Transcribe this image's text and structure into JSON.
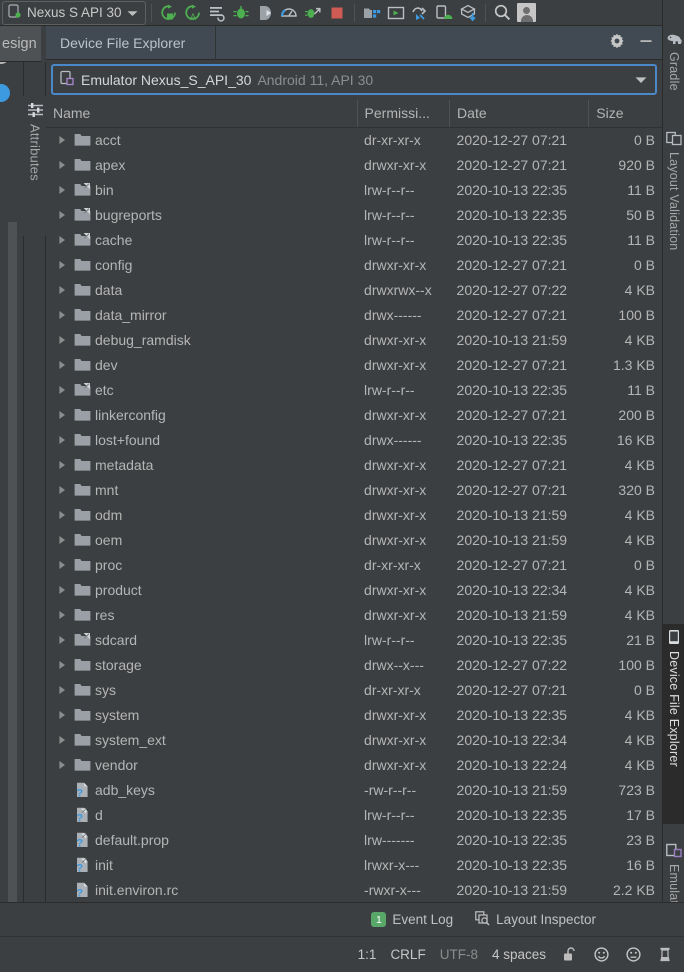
{
  "toolbar": {
    "device_selector_label": "Nexus S API 30",
    "device_selector_icon": "device-phone-icon",
    "buttons": [
      {
        "name": "run-button",
        "icon": "run-icon",
        "label": "Run"
      },
      {
        "name": "apply-changes-button",
        "icon": "apply-changes-icon",
        "label": "Apply Changes"
      },
      {
        "name": "apply-code-changes-button",
        "icon": "apply-code-changes-icon",
        "label": "Apply Code Changes"
      },
      {
        "name": "debug-button",
        "icon": "debug-icon",
        "label": "Debug"
      },
      {
        "name": "attach-debugger-button",
        "icon": "attach-debugger-icon",
        "label": "Attach Debugger to Android Process"
      },
      {
        "name": "profiler-button",
        "icon": "profiler-icon",
        "label": "Profile"
      },
      {
        "name": "run-with-coverage-button",
        "icon": "run-coverage-icon",
        "label": "Run with Coverage"
      },
      {
        "name": "stop-button",
        "icon": "stop-icon",
        "label": "Stop"
      },
      {
        "name": "sdk-manager-button",
        "icon": "sdk-manager-icon",
        "label": "SDK Manager"
      },
      {
        "name": "avd-manager-button",
        "icon": "avd-manager-icon",
        "label": "AVD Manager"
      },
      {
        "name": "layout-inspector-button",
        "icon": "layout-inspector-icon",
        "label": "Layout Inspector"
      },
      {
        "name": "device-manager-button",
        "icon": "device-android-icon",
        "label": "Device Manager"
      },
      {
        "name": "sync-gradle-button",
        "icon": "sync-project-icon",
        "label": "Sync Project with Gradle Files"
      },
      {
        "name": "search-everywhere-button",
        "icon": "search-icon",
        "label": "Search Everywhere"
      },
      {
        "name": "account-button",
        "icon": "avatar-icon",
        "label": "Account"
      }
    ]
  },
  "left_rail": {
    "design_tab_label": "esign",
    "attributes_tab_label": "Attributes",
    "attributes_tab_icon": "sliders-icon"
  },
  "right_rail": {
    "tabs": [
      {
        "name": "gradle",
        "label": "Gradle",
        "icon": "elephant-icon",
        "active": false
      },
      {
        "name": "layout-validation",
        "label": "Layout Validation",
        "icon": "layout-validation-icon",
        "active": false
      },
      {
        "name": "device-file-explorer",
        "label": "Device File Explorer",
        "icon": "device-phone-icon",
        "active": true
      },
      {
        "name": "emulator",
        "label": "Emulator",
        "icon": "emulator-icon",
        "active": false
      }
    ]
  },
  "tool_window": {
    "title": "Device File Explorer",
    "settings_icon": "gear-icon",
    "minimize_icon": "minimize-icon",
    "device_selector": {
      "icon": "device-phone-icon",
      "name": "Emulator Nexus_S_API_30",
      "detail": "Android 11, API 30",
      "chevron_icon": "chevron-down-icon"
    }
  },
  "file_table": {
    "columns": [
      "Name",
      "Permissi...",
      "Date",
      "Size"
    ],
    "rows": [
      {
        "name": "acct",
        "type": "folder",
        "expandable": true,
        "permissions": "dr-xr-xr-x",
        "date": "2020-12-27 07:21",
        "size": "0 B"
      },
      {
        "name": "apex",
        "type": "folder",
        "expandable": true,
        "permissions": "drwxr-xr-x",
        "date": "2020-12-27 07:21",
        "size": "920 B"
      },
      {
        "name": "bin",
        "type": "symfolder",
        "expandable": true,
        "permissions": "lrw-r--r--",
        "date": "2020-10-13 22:35",
        "size": "11 B"
      },
      {
        "name": "bugreports",
        "type": "symfolder",
        "expandable": true,
        "permissions": "lrw-r--r--",
        "date": "2020-10-13 22:35",
        "size": "50 B"
      },
      {
        "name": "cache",
        "type": "symfolder",
        "expandable": true,
        "permissions": "lrw-r--r--",
        "date": "2020-10-13 22:35",
        "size": "11 B"
      },
      {
        "name": "config",
        "type": "folder",
        "expandable": true,
        "permissions": "drwxr-xr-x",
        "date": "2020-12-27 07:21",
        "size": "0 B"
      },
      {
        "name": "data",
        "type": "folder",
        "expandable": true,
        "permissions": "drwxrwx--x",
        "date": "2020-12-27 07:22",
        "size": "4 KB"
      },
      {
        "name": "data_mirror",
        "type": "folder",
        "expandable": true,
        "permissions": "drwx------",
        "date": "2020-12-27 07:21",
        "size": "100 B"
      },
      {
        "name": "debug_ramdisk",
        "type": "folder",
        "expandable": true,
        "permissions": "drwxr-xr-x",
        "date": "2020-10-13 21:59",
        "size": "4 KB"
      },
      {
        "name": "dev",
        "type": "folder",
        "expandable": true,
        "permissions": "drwxr-xr-x",
        "date": "2020-12-27 07:21",
        "size": "1.3 KB"
      },
      {
        "name": "etc",
        "type": "symfolder",
        "expandable": true,
        "permissions": "lrw-r--r--",
        "date": "2020-10-13 22:35",
        "size": "11 B"
      },
      {
        "name": "linkerconfig",
        "type": "folder",
        "expandable": true,
        "permissions": "drwxr-xr-x",
        "date": "2020-12-27 07:21",
        "size": "200 B"
      },
      {
        "name": "lost+found",
        "type": "folder",
        "expandable": true,
        "permissions": "drwx------",
        "date": "2020-10-13 22:35",
        "size": "16 KB"
      },
      {
        "name": "metadata",
        "type": "folder",
        "expandable": true,
        "permissions": "drwxr-xr-x",
        "date": "2020-12-27 07:21",
        "size": "4 KB"
      },
      {
        "name": "mnt",
        "type": "folder",
        "expandable": true,
        "permissions": "drwxr-xr-x",
        "date": "2020-12-27 07:21",
        "size": "320 B"
      },
      {
        "name": "odm",
        "type": "folder",
        "expandable": true,
        "permissions": "drwxr-xr-x",
        "date": "2020-10-13 21:59",
        "size": "4 KB"
      },
      {
        "name": "oem",
        "type": "folder",
        "expandable": true,
        "permissions": "drwxr-xr-x",
        "date": "2020-10-13 21:59",
        "size": "4 KB"
      },
      {
        "name": "proc",
        "type": "folder",
        "expandable": true,
        "permissions": "dr-xr-xr-x",
        "date": "2020-12-27 07:21",
        "size": "0 B"
      },
      {
        "name": "product",
        "type": "folder",
        "expandable": true,
        "permissions": "drwxr-xr-x",
        "date": "2020-10-13 22:34",
        "size": "4 KB"
      },
      {
        "name": "res",
        "type": "folder",
        "expandable": true,
        "permissions": "drwxr-xr-x",
        "date": "2020-10-13 21:59",
        "size": "4 KB"
      },
      {
        "name": "sdcard",
        "type": "symfolder",
        "expandable": true,
        "permissions": "lrw-r--r--",
        "date": "2020-10-13 22:35",
        "size": "21 B"
      },
      {
        "name": "storage",
        "type": "folder",
        "expandable": true,
        "permissions": "drwx--x---",
        "date": "2020-12-27 07:22",
        "size": "100 B"
      },
      {
        "name": "sys",
        "type": "folder",
        "expandable": true,
        "permissions": "dr-xr-xr-x",
        "date": "2020-12-27 07:21",
        "size": "0 B"
      },
      {
        "name": "system",
        "type": "folder",
        "expandable": true,
        "permissions": "drwxr-xr-x",
        "date": "2020-10-13 22:35",
        "size": "4 KB"
      },
      {
        "name": "system_ext",
        "type": "folder",
        "expandable": true,
        "permissions": "drwxr-xr-x",
        "date": "2020-10-13 22:34",
        "size": "4 KB"
      },
      {
        "name": "vendor",
        "type": "folder",
        "expandable": true,
        "permissions": "drwxr-xr-x",
        "date": "2020-10-13 22:24",
        "size": "4 KB"
      },
      {
        "name": "adb_keys",
        "type": "file",
        "expandable": false,
        "permissions": "-rw-r--r--",
        "date": "2020-10-13 21:59",
        "size": "723 B"
      },
      {
        "name": "d",
        "type": "symfile",
        "expandable": false,
        "permissions": "lrw-r--r--",
        "date": "2020-10-13 22:35",
        "size": "17 B"
      },
      {
        "name": "default.prop",
        "type": "symfile",
        "expandable": false,
        "permissions": "lrw-------",
        "date": "2020-10-13 22:35",
        "size": "23 B"
      },
      {
        "name": "init",
        "type": "symfile",
        "expandable": false,
        "permissions": "lrwxr-x---",
        "date": "2020-10-13 22:35",
        "size": "16 B"
      },
      {
        "name": "init.environ.rc",
        "type": "file",
        "expandable": false,
        "permissions": "-rwxr-x---",
        "date": "2020-10-13 21:59",
        "size": "2.2 KB"
      }
    ]
  },
  "status_bar_top": {
    "event_log": {
      "label": "Event Log",
      "count": "1"
    },
    "layout_inspector": {
      "label": "Layout Inspector",
      "icon": "layout-inspector-icon"
    }
  },
  "status_bar_bottom": {
    "caret_position": "1:1",
    "line_separator": "CRLF",
    "encoding": "UTF-8",
    "indent": "4 spaces",
    "lock_icon": "unlocked-padlock-icon",
    "smiley_icon": "smiley-face-icon",
    "frowny_icon": "frowny-face-icon",
    "inspector_icon": "code-inspector-icon"
  },
  "colors": {
    "background": "#3c3f41",
    "panel_header": "#414a52",
    "focus_border": "#4a88c7",
    "accent_green": "#59a869",
    "folder": "#93999e",
    "text": "#b5b5b5"
  }
}
